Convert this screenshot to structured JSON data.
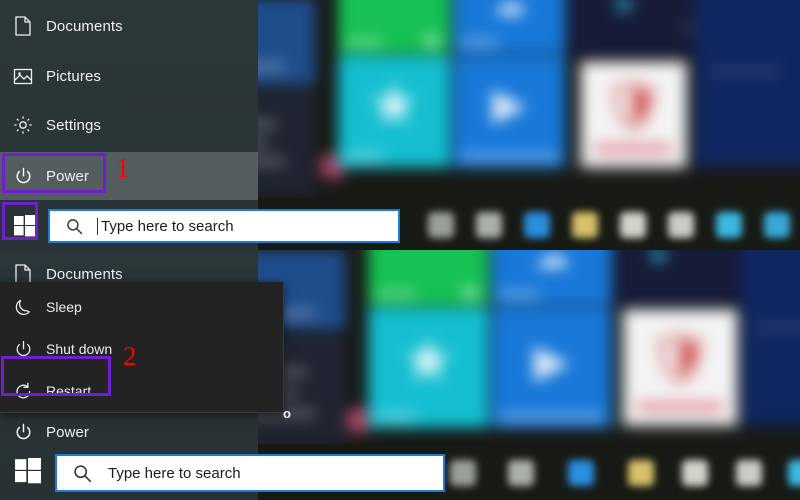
{
  "top_panel": {
    "menu_items": [
      {
        "label": "Documents",
        "icon": "document-icon"
      },
      {
        "label": "Pictures",
        "icon": "pictures-icon"
      },
      {
        "label": "Settings",
        "icon": "gear-icon"
      },
      {
        "label": "Power",
        "icon": "power-icon"
      }
    ],
    "highlighted_item": "Power",
    "step_number": "1",
    "taskbar": {
      "start_label": "Start",
      "search_placeholder": "Type here to search",
      "search_value": ""
    }
  },
  "bottom_panel": {
    "menu_items": [
      {
        "label": "Documents",
        "icon": "document-icon"
      },
      {
        "label": "Power",
        "icon": "power-icon"
      }
    ],
    "flyout_items": [
      {
        "label": "Sleep",
        "icon": "moon-icon"
      },
      {
        "label": "Shut down",
        "icon": "power-icon"
      },
      {
        "label": "Restart",
        "icon": "restart-icon"
      }
    ],
    "highlighted_item": "Restart",
    "step_number": "2",
    "artifact_text": "o",
    "taskbar": {
      "start_label": "Start",
      "search_placeholder": "Type here to search",
      "search_value": ""
    }
  },
  "colors": {
    "highlight_box": "#6f1fd0",
    "step_number": "#ff0000",
    "search_border": "#1a7fd4",
    "menu_background": "#2b3639",
    "flyout_background": "#232323"
  }
}
